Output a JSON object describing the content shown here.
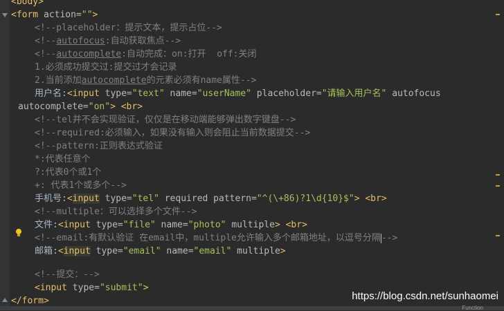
{
  "lines": {
    "l0": "<body>",
    "l1_tag": "<form ",
    "l1_attr": "action=",
    "l1_str": "\"\"",
    "l1_end": ">",
    "c1": "<!--placeholder：提示文本，提示占位-->",
    "c2_a": "<!--",
    "c2_b": "autofocus",
    "c2_c": ":自动获取焦点-->",
    "c3_a": "<!--",
    "c3_b": "autocomplete",
    "c3_c": ":自动完成：on:打开  off:关闭",
    "c4": "1.必须成功提交过:提交过才会记录",
    "c5_a": "2.当前添加",
    "c5_b": "autocomplete",
    "c5_c": "的元素必须有name属性-->",
    "u1_label": "用户名:",
    "u1_tag": "<input ",
    "u1_a1": "type=",
    "u1_s1": "\"text\"",
    "u1_a2": " name=",
    "u1_s2": "\"userName\"",
    "u1_a3": " placeholder=",
    "u1_s3": "\"请输入用户名\"",
    "u1_a4": " autofocus",
    "u2_a": "autocomplete=",
    "u2_s": "\"on\"",
    "u2_t": "> <br>",
    "c6": "<!--tel并不会实现验证，仅仅是在移动端能够弹出数字键盘-->",
    "c7": "<!--required:必须输入，如果没有输入则会阻止当前数据提交-->",
    "c8": "<!--pattern:正则表达式验证",
    "c9": "*:代表任意个",
    "c10": "?:代表0个或1个",
    "c11": "+: 代表1个或多个-->",
    "p_label": "手机号:",
    "p_lt": "<",
    "p_input": "input",
    "p_a1": " type=",
    "p_s1": "\"tel\"",
    "p_a2": " required pattern=",
    "p_s2": "\"^(\\+86)?1\\d{10}$\"",
    "p_t": "> <br>",
    "c12": "<!--multiple：可以选择多个文件-->",
    "f_label": "文件:",
    "f_tag": "<input ",
    "f_a1": "type=",
    "f_s1": "\"file\"",
    "f_a2": " name=",
    "f_s2": "\"photo\"",
    "f_a3": " multiple",
    "f_t": "> <br>",
    "c13_a": "<!--email:有默认验证",
    "c13_b": " 在email中，multiple允许输入多个邮箱地址，以逗号分隔",
    "c13_c": "-->",
    "e_label": "邮箱:",
    "e_lt": "<",
    "e_input": "input",
    "e_a1": " type=",
    "e_s1": "\"email\"",
    "e_a2": " name=",
    "e_s2": "\"email\"",
    "e_a3": " multiple",
    "e_t": ">",
    "c14": "<!--提交：-->",
    "s_tag": "<input ",
    "s_a": "type=",
    "s_s": "\"submit\"",
    "s_t": ">",
    "lend": "</form>"
  },
  "watermark": "https://blog.csdn.net/sunhaomei",
  "status_text": "Function",
  "colors": {
    "background": "#2b2b2b",
    "tag": "#e8bf6a",
    "string": "#a5c25c",
    "comment": "#808080",
    "text": "#a9b7c6"
  }
}
